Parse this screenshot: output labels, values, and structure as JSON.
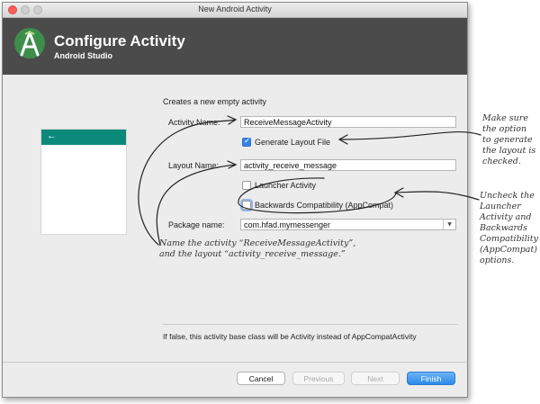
{
  "window": {
    "title": "New Android Activity"
  },
  "header": {
    "title": "Configure Activity",
    "subtitle": "Android Studio"
  },
  "form": {
    "description": "Creates a new empty activity",
    "activity_name_label": "Activity Name:",
    "activity_name_value": "ReceiveMessageActivity",
    "generate_layout_label": "Generate Layout File",
    "generate_layout_checked": true,
    "layout_name_label": "Layout Name:",
    "layout_name_value": "activity_receive_message",
    "launcher_activity_label": "Launcher Activity",
    "launcher_activity_checked": false,
    "backwards_compat_label": "Backwards Compatibility (AppCompat)",
    "backwards_compat_checked": false,
    "package_name_label": "Package name:",
    "package_name_value": "com.hfad.mymessenger"
  },
  "info_text": "If false, this activity base class will be Activity instead of AppCompatActivity",
  "footer": {
    "cancel": "Cancel",
    "previous": "Previous",
    "next": "Next",
    "finish": "Finish"
  },
  "annotations": {
    "name_note": "Name the activity “ReceiveMessageActivity”,\nand the layout “activity_receive_message.”",
    "layout_note": "Make sure\nthe option\nto generate\nthe layout is\nchecked.",
    "uncheck_note": "Uncheck the\nLauncher\nActivity and\nBackwards\nCompatibility\n(AppCompat)\noptions."
  },
  "colors": {
    "header_bg": "#4b4b4b",
    "android_green": "#78c257",
    "phone_bar": "#0b8a7a",
    "primary_button": "#2e8ae6"
  }
}
